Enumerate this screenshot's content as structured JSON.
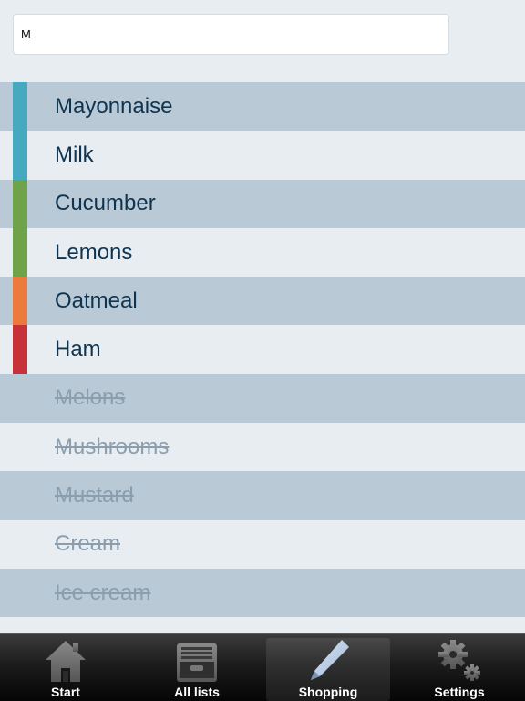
{
  "search": {
    "value": "M",
    "placeholder": ""
  },
  "colors": {
    "row_dark": "#b9c9d6",
    "row_light": "#e8edf1",
    "item_text": "#0f3450",
    "done_text": "#8b9eae",
    "stripe_teal": "#45aabf",
    "stripe_green": "#6fa34a",
    "stripe_orange": "#ec7a3d",
    "stripe_red": "#c7323a"
  },
  "items": [
    {
      "label": "Mayonnaise",
      "done": false,
      "color": "#45aabf"
    },
    {
      "label": "Milk",
      "done": false,
      "color": "#45aabf"
    },
    {
      "label": "Cucumber",
      "done": false,
      "color": "#6fa34a"
    },
    {
      "label": "Lemons",
      "done": false,
      "color": "#6fa34a"
    },
    {
      "label": "Oatmeal",
      "done": false,
      "color": "#ec7a3d"
    },
    {
      "label": "Ham",
      "done": false,
      "color": "#c7323a"
    },
    {
      "label": "Melons",
      "done": true,
      "color": ""
    },
    {
      "label": "Mushrooms",
      "done": true,
      "color": ""
    },
    {
      "label": "Mustard",
      "done": true,
      "color": ""
    },
    {
      "label": "Cream",
      "done": true,
      "color": ""
    },
    {
      "label": "Ice cream",
      "done": true,
      "color": ""
    }
  ],
  "tabs": [
    {
      "label": "Start",
      "icon": "house-icon",
      "active": false
    },
    {
      "label": "All lists",
      "icon": "inbox-tray-icon",
      "active": false
    },
    {
      "label": "Shopping",
      "icon": "pencil-icon",
      "active": true
    },
    {
      "label": "Settings",
      "icon": "gears-icon",
      "active": false
    }
  ]
}
